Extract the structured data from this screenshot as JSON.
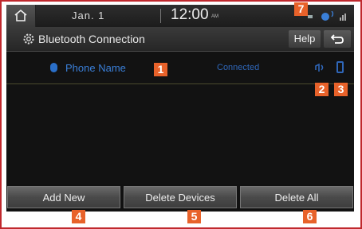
{
  "status_bar": {
    "date": "Jan.  1",
    "time": "12:00",
    "ampm": "AM"
  },
  "title_bar": {
    "title": "Bluetooth Connection",
    "help_label": "Help",
    "back_icon": "back-arrow-icon"
  },
  "device_list": {
    "devices": [
      {
        "name": "Phone Name",
        "status": "Connected"
      }
    ]
  },
  "buttons": {
    "add_new": "Add New",
    "delete_devices": "Delete Devices",
    "delete_all": "Delete All"
  },
  "callouts": [
    "1",
    "2",
    "3",
    "4",
    "5",
    "6",
    "7"
  ],
  "colors": {
    "accent_blue": "#3a7fd8",
    "callout_orange": "#e8622a",
    "frame_red": "#c0282d"
  }
}
